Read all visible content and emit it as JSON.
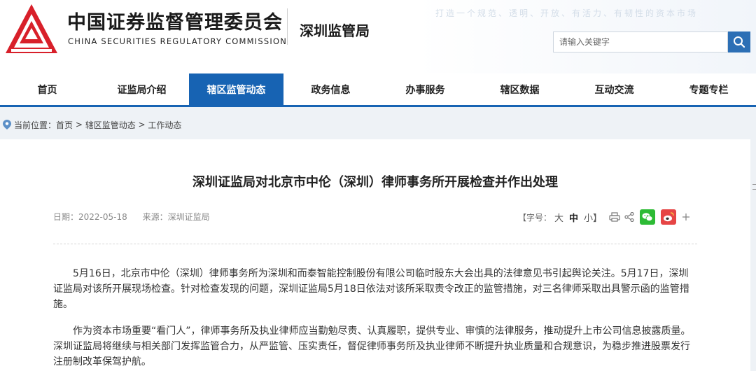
{
  "header": {
    "title_cn": "中国证券监督管理委员会",
    "title_en": "CHINA SECURITIES REGULATORY COMMISSION",
    "bureau": "深圳监管局",
    "slogan": "打造一个规范、透明、开放、有活力、有韧性的资本市场",
    "search_placeholder": "请输入关键字",
    "brand_color": "#d8202a",
    "accent_color": "#1763b3"
  },
  "nav": {
    "items": [
      {
        "label": "首页"
      },
      {
        "label": "证监局介绍"
      },
      {
        "label": "辖区监管动态"
      },
      {
        "label": "政务信息"
      },
      {
        "label": "办事服务"
      },
      {
        "label": "辖区数据"
      },
      {
        "label": "互动交流"
      },
      {
        "label": "专题专栏"
      }
    ],
    "active": "辖区监管动态"
  },
  "breadcrumb": {
    "prefix": "当前位置：",
    "items": [
      "首页",
      "辖区监管动态",
      "工作动态"
    ],
    "separator": " > "
  },
  "article": {
    "title": "深圳证监局对北京市中伦（深圳）律师事务所开展检查并作出处理",
    "date": "日期：2022-05-18",
    "source": "来源：深圳证监局",
    "font_size_label": "【字号：",
    "font_sizes": [
      "大",
      "中",
      "小】"
    ],
    "paragraphs": [
      "5月16日，北京市中伦（深圳）律师事务所为深圳和而泰智能控制股份有限公司临时股东大会出具的法律意见书引起舆论关注。5月17日，深圳证监局对该所开展现场检查。针对检查发现的问题，深圳证监局5月18日依法对该所采取责令改正的监管措施，对三名律师采取出具警示函的监管措施。",
      "作为资本市场重要“看门人”，律师事务所及执业律师应当勤勉尽责、认真履职，提供专业、审慎的法律服务，推动提升上市公司信息披露质量。深圳证监局将继续与相关部门发挥监管合力，从严监管、压实责任，督促律师事务所及执业律师不断提升执业质量和合规意识，为稳步推进股票发行注册制改革保驾护航。"
    ]
  },
  "icons": [
    "logo-emblem",
    "search-icon",
    "location-pin-icon",
    "print-icon",
    "share-icon",
    "wechat-icon",
    "weibo-icon",
    "plus-icon"
  ]
}
